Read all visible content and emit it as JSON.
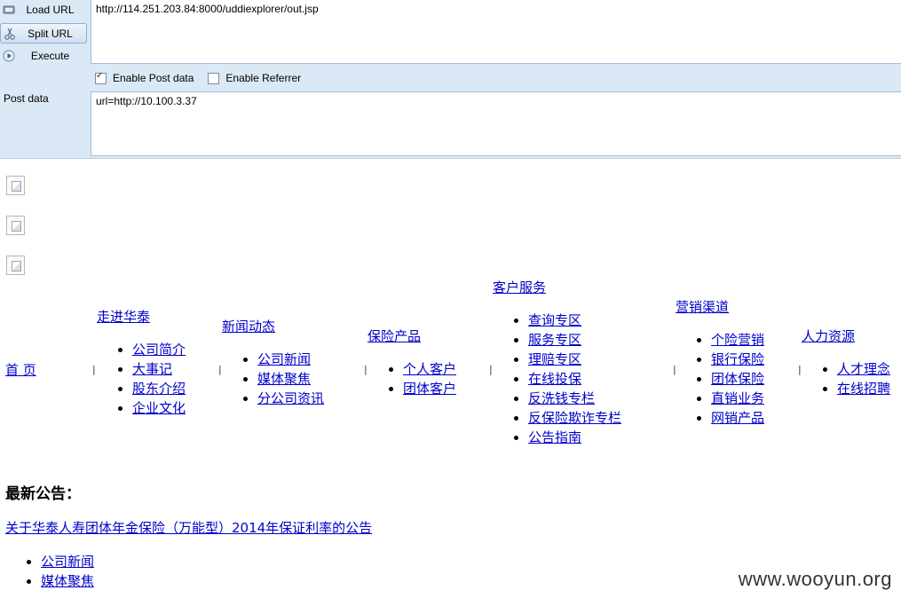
{
  "hackbar": {
    "load_url_label": "Load URL",
    "split_url_label": "Split URL",
    "execute_label": "Execute",
    "url_value": "http://114.251.203.84:8000/uddiexplorer/out.jsp",
    "enable_post_label": "Enable Post data",
    "enable_post_checked": true,
    "enable_referrer_label": "Enable Referrer",
    "enable_referrer_checked": false,
    "post_data_label": "Post data",
    "post_data_value": "url=http://10.100.3.37"
  },
  "nav": {
    "home": "首 页",
    "separator": "|",
    "columns": [
      {
        "head": "走进华泰",
        "items": [
          "公司简介",
          "大事记",
          "股东介绍",
          "企业文化"
        ]
      },
      {
        "head": "新闻动态",
        "items": [
          "公司新闻",
          "媒体聚焦",
          "分公司资讯"
        ]
      },
      {
        "head": "保险产品",
        "items": [
          "个人客户",
          "团体客户"
        ]
      },
      {
        "head": "客户服务",
        "items": [
          "查询专区",
          "服务专区",
          "理赔专区",
          "在线投保",
          "反洗钱专栏",
          "反保险欺诈专栏",
          "公告指南"
        ]
      },
      {
        "head": "营销渠道",
        "items": [
          "个险营销",
          "银行保险",
          "团体保险",
          "直销业务",
          "网销产品"
        ]
      },
      {
        "head": "人力资源",
        "items": [
          "人才理念",
          "在线招聘"
        ]
      }
    ]
  },
  "notice": {
    "title": "最新公告：",
    "link": "关于华泰人寿团体年金保险（万能型）2014年保证利率的公告",
    "list": [
      "公司新闻",
      "媒体聚焦"
    ]
  },
  "watermark": "www.wooyun.org",
  "colors": {
    "link": "#0000cc",
    "toolbar_bg": "#dbe8f5"
  }
}
